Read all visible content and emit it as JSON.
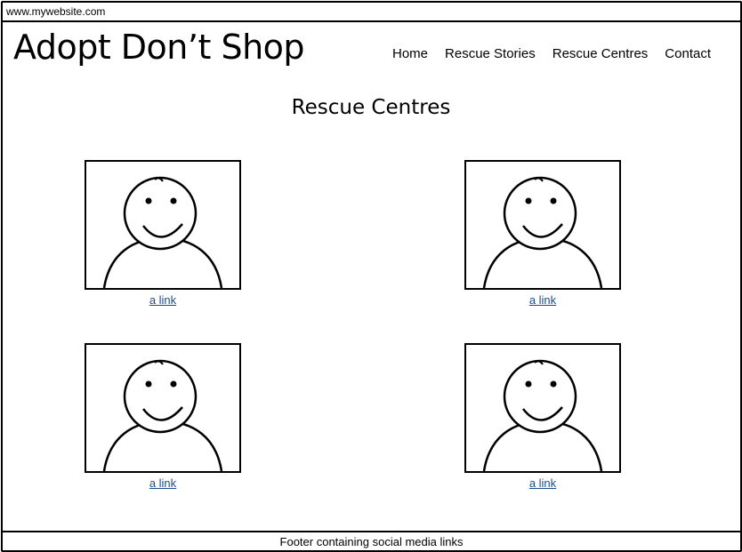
{
  "browser": {
    "url": "www.mywebsite.com"
  },
  "header": {
    "logo": "Adopt Don’t Shop",
    "nav": [
      "Home",
      "Rescue Stories",
      "Rescue Centres",
      "Contact"
    ]
  },
  "main": {
    "title": "Rescue Centres",
    "cards": [
      {
        "link": "a link"
      },
      {
        "link": "a link"
      },
      {
        "link": "a link"
      },
      {
        "link": "a link"
      }
    ]
  },
  "footer": {
    "text": "Footer containing social media links"
  },
  "colors": {
    "link": "#1f4e8c",
    "stroke": "#000000",
    "background": "#ffffff"
  }
}
